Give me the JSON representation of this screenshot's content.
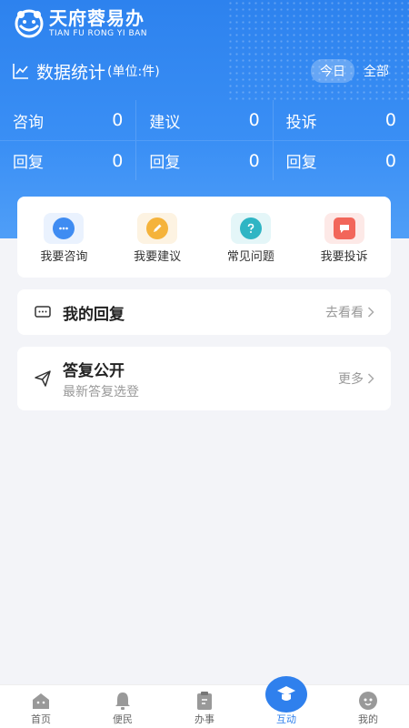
{
  "app": {
    "name": "天府蓉易办",
    "name_pinyin": "TIAN FU RONG YI BAN"
  },
  "stats": {
    "title": "数据统计",
    "unit": "(单位:件)",
    "filters": [
      {
        "label": "今日",
        "active": true
      },
      {
        "label": "全部",
        "active": false
      }
    ],
    "rows": [
      [
        {
          "label": "咨询",
          "value": "0"
        },
        {
          "label": "建议",
          "value": "0"
        },
        {
          "label": "投诉",
          "value": "0"
        }
      ],
      [
        {
          "label": "回复",
          "value": "0"
        },
        {
          "label": "回复",
          "value": "0"
        },
        {
          "label": "回复",
          "value": "0"
        }
      ]
    ]
  },
  "actions": [
    {
      "label": "我要咨询",
      "icon": "chat-bubble-icon",
      "color": "#3f8cf2",
      "bg": "#eaf2fe"
    },
    {
      "label": "我要建议",
      "icon": "pencil-icon",
      "color": "#f5b33b",
      "bg": "#fdf3e2"
    },
    {
      "label": "常见问题",
      "icon": "question-icon",
      "color": "#2fb5c4",
      "bg": "#e4f6f8"
    },
    {
      "label": "我要投诉",
      "icon": "complaint-icon",
      "color": "#f2665a",
      "bg": "#fde9e7"
    }
  ],
  "my_reply": {
    "title": "我的回复",
    "more": "去看看"
  },
  "public_reply": {
    "title": "答复公开",
    "subtitle": "最新答复选登",
    "more": "更多"
  },
  "tabbar": [
    {
      "label": "首页",
      "icon": "home-icon",
      "active": false
    },
    {
      "label": "便民",
      "icon": "bell-icon",
      "active": false
    },
    {
      "label": "办事",
      "icon": "clipboard-icon",
      "active": false
    },
    {
      "label": "互动",
      "icon": "interact-icon",
      "active": true
    },
    {
      "label": "我的",
      "icon": "user-icon",
      "active": false
    }
  ],
  "colors": {
    "primary": "#2f80ed",
    "header_top": "#2d82ee",
    "header_bottom": "#4f9ef7",
    "background": "#f3f4f8"
  }
}
